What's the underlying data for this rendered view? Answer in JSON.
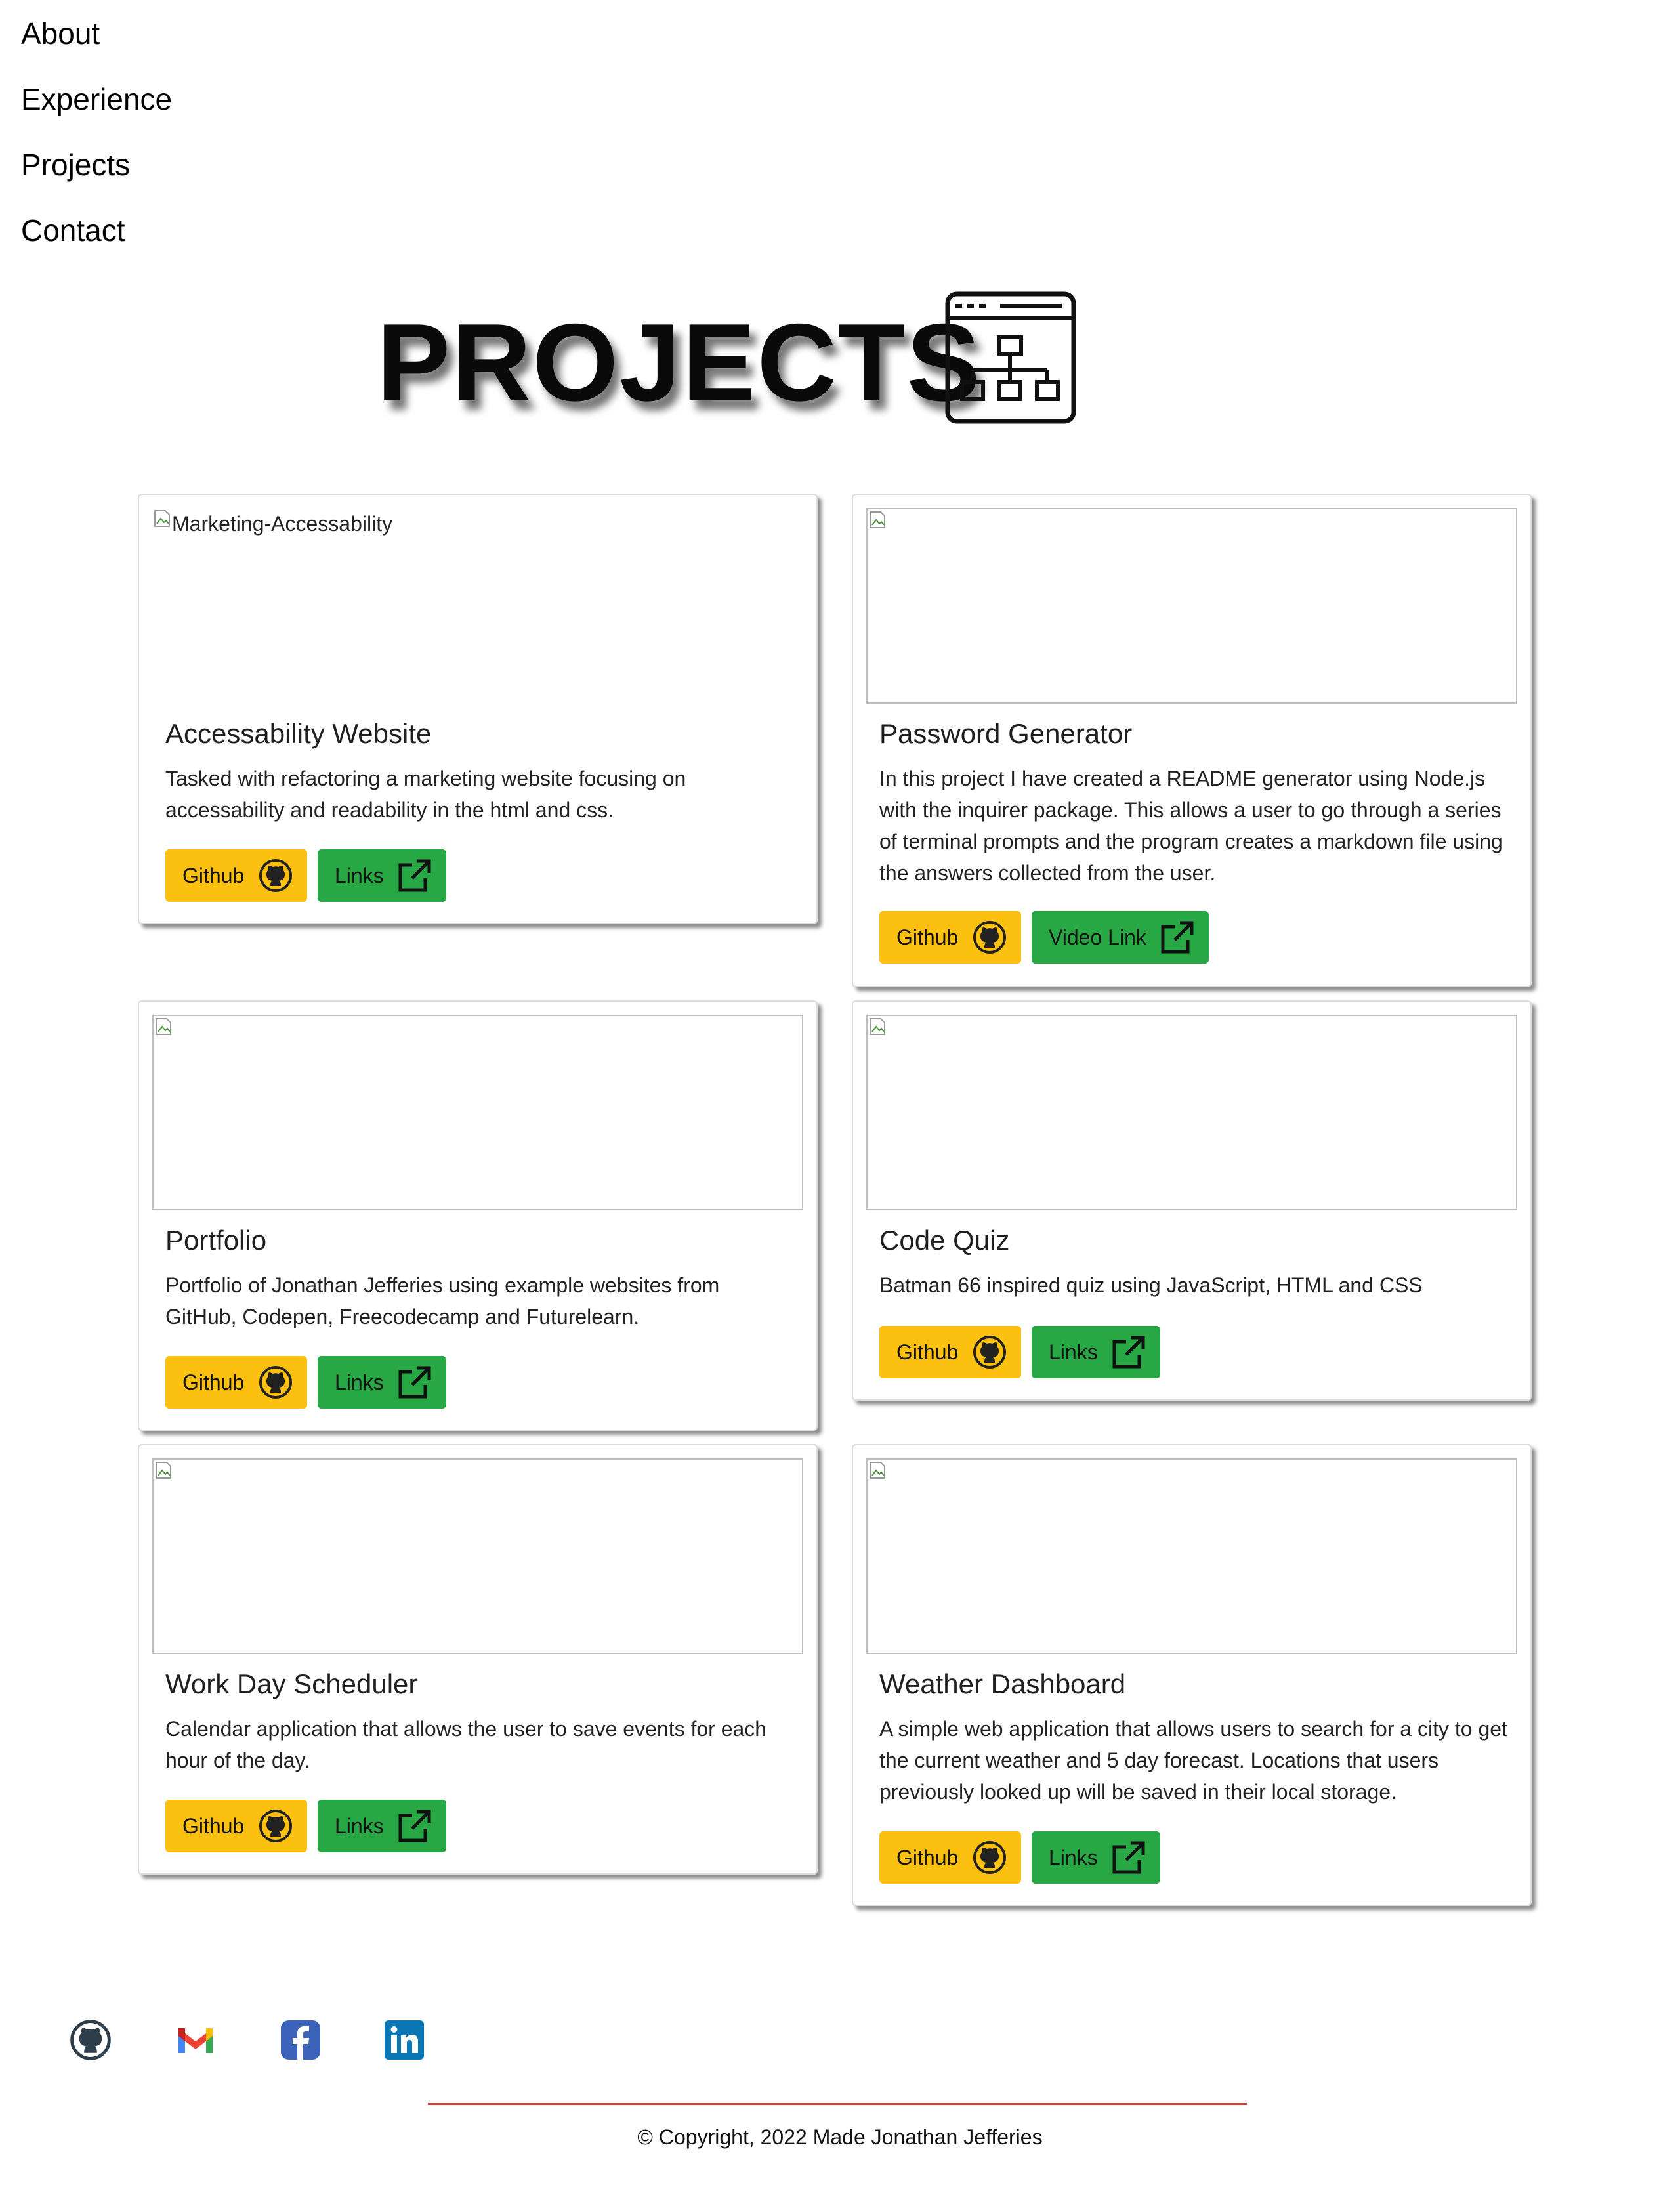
{
  "nav": [
    "About",
    "Experience",
    "Projects",
    "Contact"
  ],
  "hero": {
    "title": "PROJECTS",
    "icon": "sitemap-icon"
  },
  "projects": [
    {
      "image_alt": "Marketing-Accessability",
      "title": "Accessability Website",
      "description": "Tasked with refactoring a marketing website focusing on accessability and readability in the html and css.",
      "github_label": "Github",
      "link_label": "Links"
    },
    {
      "image_alt": "",
      "title": "Password Generator",
      "description": "In this project I have created a README generator using Node.js with the inquirer package. This allows a user to go through a series of terminal prompts and the program creates a markdown file using the answers collected from the user.",
      "github_label": "Github",
      "link_label": "Video Link"
    },
    {
      "image_alt": "",
      "title": "Portfolio",
      "description": "Portfolio of Jonathan Jefferies using example websites from GitHub, Codepen, Freecodecamp and Futurelearn.",
      "github_label": "Github",
      "link_label": "Links"
    },
    {
      "image_alt": "",
      "title": "Code Quiz",
      "description": "Batman 66 inspired quiz using JavaScript, HTML and CSS",
      "github_label": "Github",
      "link_label": "Links"
    },
    {
      "image_alt": "",
      "title": "Work Day Scheduler",
      "description": "Calendar application that allows the user to save events for each hour of the day.",
      "github_label": "Github",
      "link_label": "Links"
    },
    {
      "image_alt": "",
      "title": "Weather Dashboard",
      "description": "A simple web application that allows users to search for a city to get the current weather and 5 day forecast. Locations that users previously looked up will be saved in their local storage.",
      "github_label": "Github",
      "link_label": "Links"
    }
  ],
  "social": [
    "github-icon",
    "gmail-icon",
    "facebook-icon",
    "linkedin-icon"
  ],
  "footer": {
    "copyright": "© Copyright, 2022 Made Jonathan Jefferies"
  },
  "colors": {
    "github_button": "#fcc010",
    "link_button": "#28a745",
    "footer_rule": "#d43f3a"
  }
}
